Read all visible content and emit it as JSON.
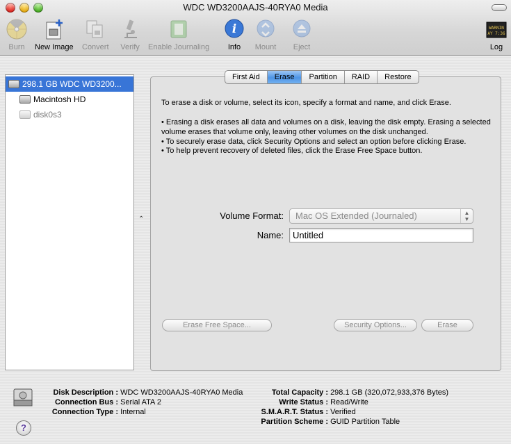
{
  "window": {
    "title": "WDC WD3200AAJS-40RYA0 Media"
  },
  "toolbar": {
    "burn": "Burn",
    "new_image": "New Image",
    "convert": "Convert",
    "verify": "Verify",
    "enable_journaling": "Enable Journaling",
    "info": "Info",
    "mount": "Mount",
    "eject": "Eject",
    "log": "Log",
    "log_icon_text_1": "WARNIN",
    "log_icon_text_2": "AY 7:36"
  },
  "devices": [
    {
      "label": "298.1 GB WDC WD3200...",
      "selected": true
    },
    {
      "label": "Macintosh HD",
      "selected": false
    },
    {
      "label": "disk0s3",
      "selected": false
    }
  ],
  "tabs": [
    "First Aid",
    "Erase",
    "Partition",
    "RAID",
    "Restore"
  ],
  "active_tab": "Erase",
  "erase": {
    "intro": "To erase a disk or volume, select its icon, specify a format and name, and click Erase.",
    "bullet1": "• Erasing a disk erases all data and volumes on a disk, leaving the disk empty. Erasing a selected volume erases that volume only, leaving other volumes on the disk unchanged.",
    "bullet2": "• To securely erase data, click Security Options and select an option before clicking Erase.",
    "bullet3": "• To help prevent recovery of deleted files, click the Erase Free Space button.",
    "volume_format_label": "Volume Format:",
    "volume_format_value": "Mac OS Extended (Journaled)",
    "name_label": "Name:",
    "name_value": "Untitled",
    "erase_free_space": "Erase Free Space...",
    "security_options": "Security Options...",
    "erase": "Erase"
  },
  "details": {
    "disk_description_label": "Disk Description :",
    "disk_description": "WDC WD3200AAJS-40RYA0 Media",
    "connection_bus_label": "Connection Bus :",
    "connection_bus": "Serial ATA 2",
    "connection_type_label": "Connection Type :",
    "connection_type": "Internal",
    "total_capacity_label": "Total Capacity :",
    "total_capacity": "298.1 GB (320,072,933,376 Bytes)",
    "write_status_label": "Write Status :",
    "write_status": "Read/Write",
    "smart_status_label": "S.M.A.R.T. Status :",
    "smart_status": "Verified",
    "partition_scheme_label": "Partition Scheme :",
    "partition_scheme": "GUID Partition Table"
  },
  "help": "?",
  "colors": {
    "selection": "#3875d7",
    "active_tab": "#4d94e6"
  }
}
